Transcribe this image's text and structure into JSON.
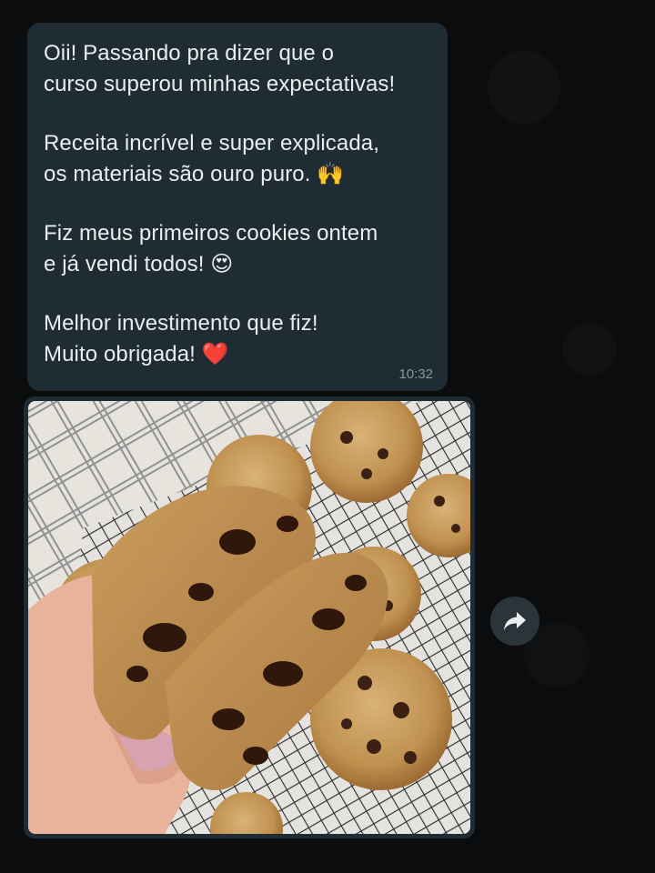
{
  "message": {
    "paragraphs": [
      "Oii! Passando pra dizer que o\ncurso superou minhas expectativas!",
      "Receita incrível e super explicada,\nos materiais são ouro puro. 🙌",
      "Fiz meus primeiros cookies ontem\ne já vendi todos! 😍",
      "Melhor investimento que fiz!\nMuito obrigada! ❤️"
    ],
    "time": "10:32"
  },
  "image_message": {
    "image_icon": "cookie-photo"
  },
  "forward": {
    "icon": "forward-arrow-icon"
  },
  "colors": {
    "chat_background": "#0b0c0d",
    "bubble": "#202c33",
    "text": "#e9edef",
    "time": "#8696a0"
  }
}
